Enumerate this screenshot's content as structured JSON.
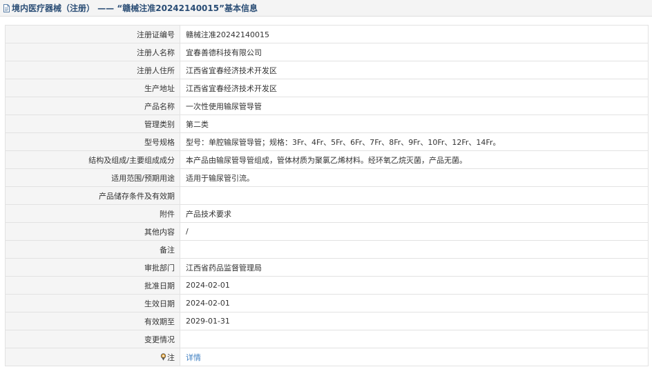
{
  "header": {
    "title": "境内医疗器械（注册） —— “赣械注准20242140015”基本信息",
    "icon": "document-icon"
  },
  "rows": [
    {
      "label": "注册证编号",
      "value": "赣械注准20242140015"
    },
    {
      "label": "注册人名称",
      "value": "宜春善德科技有限公司"
    },
    {
      "label": "注册人住所",
      "value": "江西省宜春经济技术开发区"
    },
    {
      "label": "生产地址",
      "value": "江西省宜春经济技术开发区"
    },
    {
      "label": "产品名称",
      "value": "一次性使用输尿管导管"
    },
    {
      "label": "管理类别",
      "value": "第二类"
    },
    {
      "label": "型号规格",
      "value": "型号：单腔输尿管导管；规格：3Fr、4Fr、5Fr、6Fr、7Fr、8Fr、9Fr、10Fr、12Fr、14Fr。"
    },
    {
      "label": "结构及组成/主要组成成分",
      "value": "本产品由输尿管导管组成，管体材质为聚氯乙烯材料。经环氧乙烷灭菌，产品无菌。"
    },
    {
      "label": "适用范围/预期用途",
      "value": "适用于输尿管引流。"
    },
    {
      "label": "产品储存条件及有效期",
      "value": ""
    },
    {
      "label": "附件",
      "value": "产品技术要求"
    },
    {
      "label": "其他内容",
      "value": "/"
    },
    {
      "label": "备注",
      "value": ""
    },
    {
      "label": "审批部门",
      "value": "江西省药品监督管理局"
    },
    {
      "label": "批准日期",
      "value": "2024-02-01"
    },
    {
      "label": "生效日期",
      "value": "2024-02-01"
    },
    {
      "label": "有效期至",
      "value": "2029-01-31"
    },
    {
      "label": "变更情况",
      "value": ""
    }
  ],
  "note_row": {
    "label": "注",
    "icon": "pin-icon",
    "link_text": "详情"
  },
  "colors": {
    "title_text": "#2a4d75",
    "label_bg": "#f5f5f5",
    "border": "#e2e2e2",
    "link": "#3f7fc1"
  }
}
